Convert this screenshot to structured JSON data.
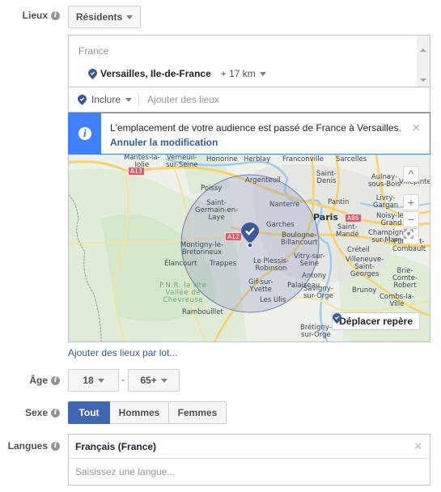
{
  "locations": {
    "label": "Lieux",
    "type_dropdown": "Résidents",
    "group_header": "France",
    "selected_location": "Versailles, Ile-de-France",
    "radius": "+ 17 km",
    "include_dropdown": "Inclure",
    "add_placeholder": "Ajouter des lieux",
    "notice": {
      "text": "L'emplacement de votre audience est passé de France à Versailles.",
      "undo_link": "Annuler la modification"
    },
    "map": {
      "labels": [
        {
          "text": "Mantes-la-\nJolie",
          "kind": "small"
        },
        {
          "text": "Verneuil-\nsur-Seine",
          "kind": "small"
        },
        {
          "text": "Honorine",
          "kind": "small"
        },
        {
          "text": "Herblay",
          "kind": "small"
        },
        {
          "text": "Franconville",
          "kind": "small"
        },
        {
          "text": "Sarcelles",
          "kind": "small"
        },
        {
          "text": "Poissy",
          "kind": "small"
        },
        {
          "text": "Argenteuil",
          "kind": "small"
        },
        {
          "text": "Saint-\nDenis",
          "kind": "small"
        },
        {
          "text": "Aulnay-\nsous-Bois",
          "kind": "small"
        },
        {
          "text": "Villepinte",
          "kind": "small"
        },
        {
          "text": "Saint-\nGermain-en-\nLaye",
          "kind": "small"
        },
        {
          "text": "Nanterre",
          "kind": "small"
        },
        {
          "text": "Pantin",
          "kind": "small"
        },
        {
          "text": "Livry-\nGargan",
          "kind": "small"
        },
        {
          "text": "Paris",
          "kind": "big"
        },
        {
          "text": "Noisy-le-\nGrand",
          "kind": "small"
        },
        {
          "text": "Garches",
          "kind": "small"
        },
        {
          "text": "Boulogne-\nBillancourt",
          "kind": "small"
        },
        {
          "text": "Saint-\nMandé",
          "kind": "small"
        },
        {
          "text": "Champigny-\nsur-Marne",
          "kind": "small"
        },
        {
          "text": "Montigny-le-\nBretonneux",
          "kind": "small"
        },
        {
          "text": "Élancourt",
          "kind": "small"
        },
        {
          "text": "Trappes",
          "kind": "small"
        },
        {
          "text": "Le Plessis-\nRobinson",
          "kind": "small"
        },
        {
          "text": "Vitry-sur-\nSeine",
          "kind": "small"
        },
        {
          "text": "Créteil",
          "kind": "small"
        },
        {
          "text": "Pontault-\nCombault",
          "kind": "small"
        },
        {
          "text": "Antony",
          "kind": "small"
        },
        {
          "text": "Villeneuve-\nSaint-\nGeorges",
          "kind": "small"
        },
        {
          "text": "P.N.R. la Hte\nVallée de\nChevreuse",
          "kind": "park"
        },
        {
          "text": "Gif-sur-\nYvette",
          "kind": "small"
        },
        {
          "text": "Palaiseau",
          "kind": "small"
        },
        {
          "text": "Brie-\nComte-\nRobert",
          "kind": "small"
        },
        {
          "text": "Les Ulis",
          "kind": "small"
        },
        {
          "text": "Savigny-\nsur-Orge",
          "kind": "small"
        },
        {
          "text": "Brunoy",
          "kind": "small"
        },
        {
          "text": "Rambouillet",
          "kind": "small"
        },
        {
          "text": "Combs-la-\nVille",
          "kind": "small"
        },
        {
          "text": "Brétigny-\nsur-Orge",
          "kind": "small"
        }
      ],
      "road_shields": [
        "A13",
        "A12",
        "A86"
      ],
      "controls": {
        "collapse": "^",
        "zoom_in": "+",
        "zoom_out": "−"
      },
      "move_pin_button": "Déplacer repère",
      "colors": {
        "radius_fill": "#9aa3c9",
        "pin": "#3b5998"
      }
    },
    "bulk_add_link": "Ajouter des lieux par lot..."
  },
  "age": {
    "label": "Âge",
    "min": "18",
    "separator": "-",
    "max": "65+"
  },
  "gender": {
    "label": "Sexe",
    "options": [
      "Tout",
      "Hommes",
      "Femmes"
    ],
    "selected": "Tout"
  },
  "languages": {
    "label": "Langues",
    "selected": "Français (France)",
    "placeholder": "Saisissez une langue..."
  }
}
